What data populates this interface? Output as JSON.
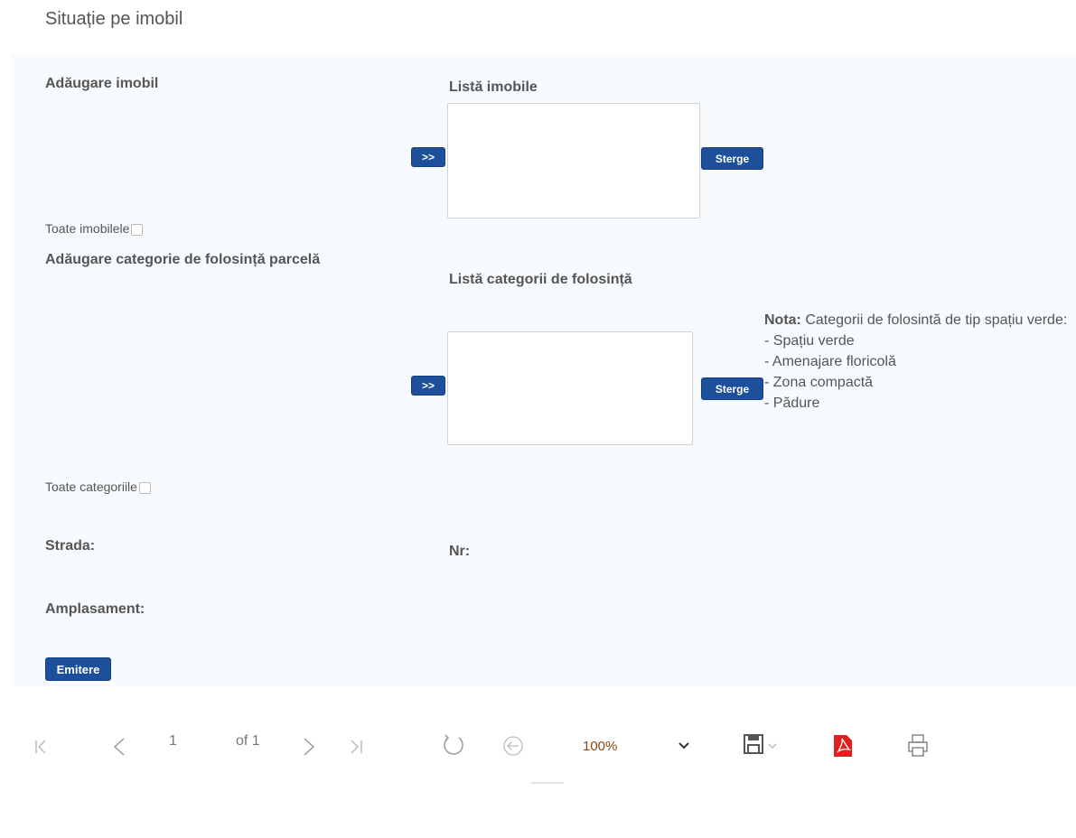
{
  "page": {
    "title": "Situație pe imobil"
  },
  "imobil": {
    "add_label": "Adăugare imobil",
    "list_label": "Listă imobile",
    "add_button": ">>",
    "delete_button": "Sterge",
    "all_label": "Toate imobilele"
  },
  "categorie": {
    "add_label": "Adăugare categorie de folosință parcelă",
    "list_label": "Listă categorii de folosință",
    "add_button": ">>",
    "delete_button": "Sterge",
    "all_label": "Toate categoriile"
  },
  "note": {
    "prefix": "Nota:",
    "text": "Categorii de folosintă de tip spațiu verde:",
    "items": [
      "- Spațiu verde",
      "- Amenajare floricolă",
      "- Zona compactă",
      "- Pădure"
    ]
  },
  "fields": {
    "strada": "Strada:",
    "nr": "Nr:",
    "amplasament": "Amplasament:"
  },
  "emit_button": "Emitere",
  "toolbar": {
    "page_current": "1",
    "page_total": "of 1",
    "zoom": "100%",
    "icons": {
      "first": "first-page-icon",
      "prev": "prev-page-icon",
      "next": "next-page-icon",
      "last": "last-page-icon",
      "refresh": "refresh-icon",
      "back": "back-icon",
      "zoom_dropdown": "chevron-down-icon",
      "save": "save-icon",
      "pdf": "pdf-icon",
      "print": "print-icon"
    }
  },
  "colors": {
    "button": "#1d4f9b",
    "pdf": "#e02020",
    "zoom_text": "#8b4513"
  }
}
